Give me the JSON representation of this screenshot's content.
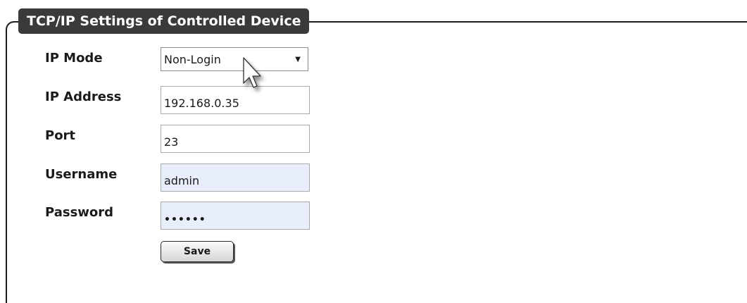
{
  "panel": {
    "title": "TCP/IP Settings of Controlled Device"
  },
  "form": {
    "ip_mode": {
      "label": "IP Mode",
      "value": "Non-Login"
    },
    "ip_address": {
      "label": "IP Address",
      "value": "192.168.0.35"
    },
    "port": {
      "label": "Port",
      "value": "23"
    },
    "username": {
      "label": "Username",
      "value": "admin"
    },
    "password": {
      "label": "Password",
      "masked_value": "••••••"
    },
    "save_label": "Save"
  },
  "icons": {
    "cursor": "mouse-pointer-icon",
    "dropdown": "dropdown-arrow-icon"
  },
  "colors": {
    "legend_background": "#3a3a3a",
    "autofill_background": "#e8eefc"
  }
}
